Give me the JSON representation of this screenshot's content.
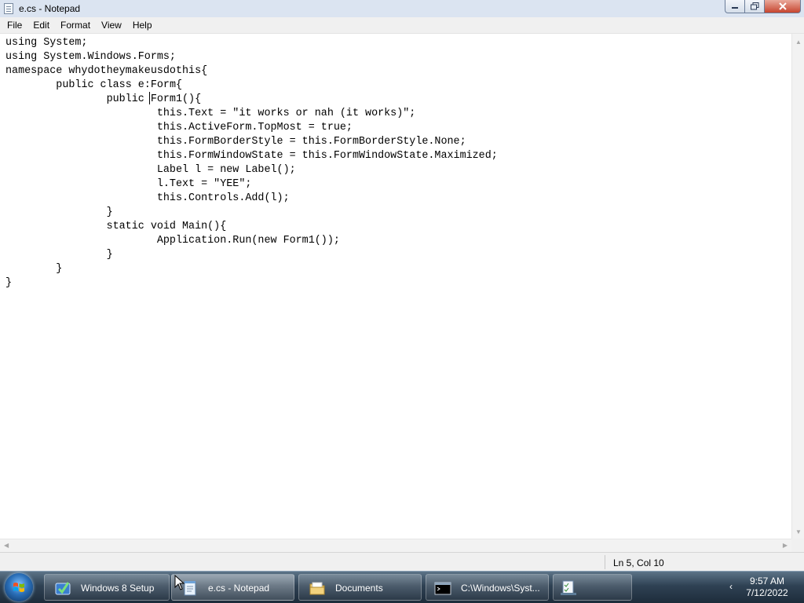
{
  "window": {
    "title": "e.cs - Notepad",
    "controls": {
      "minimize": "minimize",
      "maximize": "maximize",
      "close": "close"
    }
  },
  "menu": [
    "File",
    "Edit",
    "Format",
    "View",
    "Help"
  ],
  "editor": {
    "text": "using System;\nusing System.Windows.Forms;\nnamespace whydotheymakeusdothis{\n\tpublic class e:Form{\n\t\tpublic Form1(){\n\t\t\tthis.Text = \"it works or nah (it works)\";\n\t\t\tthis.ActiveForm.TopMost = true;\n\t\t\tthis.FormBorderStyle = this.FormBorderStyle.None;\n\t\t\tthis.FormWindowState = this.FormWindowState.Maximized;\n\t\t\tLabel l = new Label();\n\t\t\tl.Text = \"YEE\";\n\t\t\tthis.Controls.Add(l);\n\t\t}\n\t\tstatic void Main(){\n\t\t\tApplication.Run(new Form1());\n\t\t}\n\t}\n}"
  },
  "status": {
    "position": "Ln 5, Col 10"
  },
  "taskbar": {
    "items": [
      {
        "label": "Windows 8 Setup",
        "icon": "setup-icon",
        "active": false
      },
      {
        "label": "e.cs - Notepad",
        "icon": "notepad-icon",
        "active": true
      },
      {
        "label": "Documents",
        "icon": "folder-icon",
        "active": false
      },
      {
        "label": "C:\\Windows\\Syst...",
        "icon": "cmd-icon",
        "active": false
      },
      {
        "label": "",
        "icon": "task-manager-icon",
        "active": false
      }
    ],
    "clock": {
      "time": "9:57 AM",
      "date": "7/12/2022"
    }
  },
  "colors": {
    "taskbar": "#2f4254",
    "title_bar": "#dbe4f1",
    "close_button": "#c7452f"
  }
}
